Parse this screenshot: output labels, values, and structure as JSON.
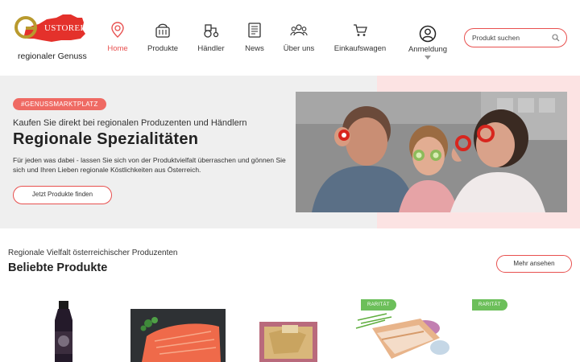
{
  "header": {
    "logo": {
      "brand": "USTOREICH",
      "tagline": "regionaler Genuss"
    },
    "nav": [
      {
        "label": "Home",
        "icon": "location-pin-icon",
        "active": true
      },
      {
        "label": "Produkte",
        "icon": "basket-icon",
        "active": false
      },
      {
        "label": "Händler",
        "icon": "tractor-icon",
        "active": false
      },
      {
        "label": "News",
        "icon": "newspaper-icon",
        "active": false
      },
      {
        "label": "Über uns",
        "icon": "people-icon",
        "active": false
      },
      {
        "label": "Einkaufswagen",
        "icon": "cart-icon",
        "active": false
      },
      {
        "label": "Anmeldung",
        "icon": "user-circle-icon",
        "active": false
      }
    ],
    "search": {
      "placeholder": "Produkt suchen",
      "value": ""
    }
  },
  "hero": {
    "tag": "#GENUSSMARKTPLATZ",
    "subtitle": "Kaufen Sie direkt bei regionalen Produzenten und Händlern",
    "title": "Regionale Spezialitäten",
    "text": "Für jeden was dabei - lassen Sie sich von der Produktvielfalt überraschen und gönnen Sie sich und Ihren Lieben regionale Köstlichkeiten aus Österreich.",
    "button": "Jetzt Produkte finden"
  },
  "products_section": {
    "subtitle": "Regionale Vielfalt österreichischer Produzenten",
    "title": "Beliebte Produkte",
    "more_button": "Mehr ansehen",
    "badges": [
      "RARITÄT",
      "RARITÄT"
    ]
  },
  "colors": {
    "accent": "#e8504f",
    "badge_green": "#6cbf5a",
    "hero_bg": "#efefef",
    "hero_pink": "#fce3e3"
  }
}
